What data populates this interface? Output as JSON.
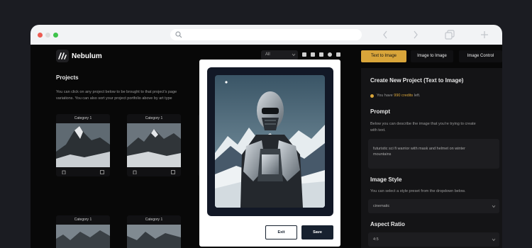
{
  "app": {
    "brand": "Nebulum"
  },
  "toolbar": {
    "filter_value": "All"
  },
  "projects": {
    "title": "Projects",
    "intro_line1": "You can click on any project below to be brought to that project's page",
    "intro_line2": "variations. You can also sort your project portfolio above by art type"
  },
  "cards": [
    {
      "category": "Category 1"
    },
    {
      "category": "Category 1"
    }
  ],
  "tabs": [
    "Text to Image",
    "Image to Image",
    "Image Control"
  ],
  "panel": {
    "title": "Create New Project (Text to Image)",
    "credits_prefix": "You have",
    "credits_value": "990 credits",
    "credits_suffix": "left.",
    "prompt_heading": "Prompt",
    "prompt_desc_line1": "Below you can describe the image that you're trying to create",
    "prompt_desc_line2": "with text.",
    "prompt_value_line1": "futuristic sci fi warrior with mask and helmet on winter",
    "prompt_value_line2": "mountains",
    "style_heading": "Image Style",
    "style_desc": "You can select a style preset from the dropdown below.",
    "style_value": "cinematic",
    "ratio_heading": "Aspect Ratio",
    "ratio_value": "4:5"
  },
  "modal": {
    "exit_label": "Exit",
    "save_label": "Save"
  },
  "colors": {
    "accent": "#d9a53a",
    "modal_button": "#17212f",
    "frame": "#121826"
  }
}
